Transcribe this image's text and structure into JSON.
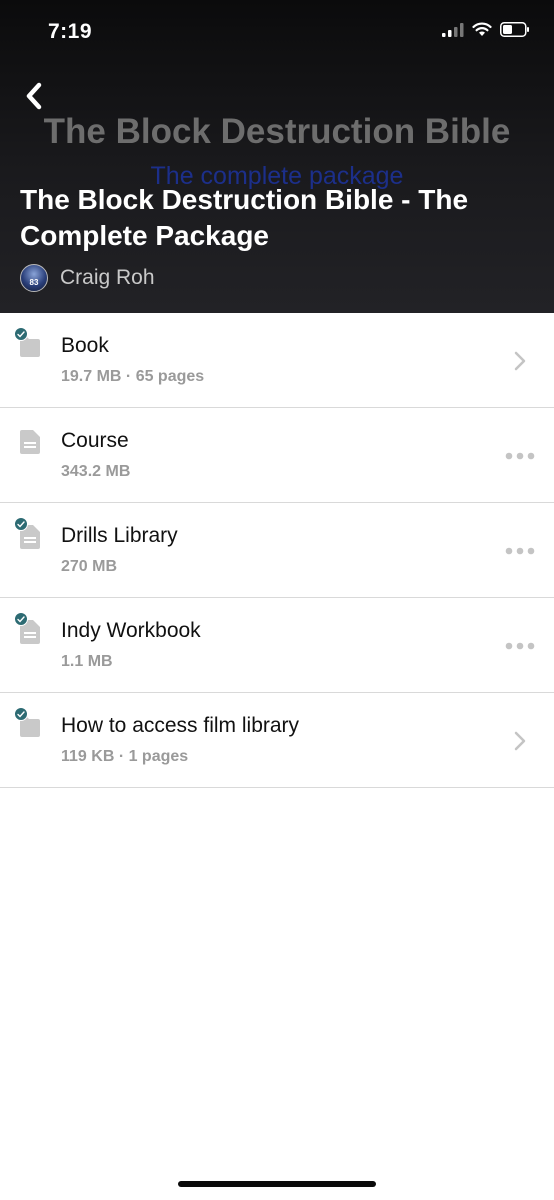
{
  "status_bar": {
    "time": "7:19",
    "icons": [
      "cellular-signal-icon",
      "wifi-icon",
      "battery-icon"
    ]
  },
  "header": {
    "back_icon": "chevron-left-icon",
    "cover_title": "The Block Destruction Bible",
    "cover_subtitle": "The complete package",
    "title": "The Block Destruction Bible - The Complete Package",
    "author": {
      "name": "Craig Roh",
      "avatar_number": "83"
    }
  },
  "files": [
    {
      "name": "Book",
      "meta": "19.7 MB · 65 pages",
      "icon": "folder-icon",
      "checked": true,
      "action": "chevron-right-icon"
    },
    {
      "name": "Course",
      "meta": "343.2 MB",
      "icon": "document-icon",
      "checked": false,
      "action": "more-icon"
    },
    {
      "name": "Drills Library",
      "meta": "270 MB",
      "icon": "document-icon",
      "checked": true,
      "action": "more-icon"
    },
    {
      "name": "Indy Workbook",
      "meta": "1.1 MB",
      "icon": "document-icon",
      "checked": true,
      "action": "more-icon"
    },
    {
      "name": "How to access film library",
      "meta": "119 KB · 1 pages",
      "icon": "folder-icon",
      "checked": true,
      "action": "chevron-right-icon"
    }
  ],
  "colors": {
    "header_bg": "#151517",
    "check_badge": "#2d6b73",
    "meta_text": "#9a9a9a",
    "cover_subtitle": "#1c2f8a"
  }
}
